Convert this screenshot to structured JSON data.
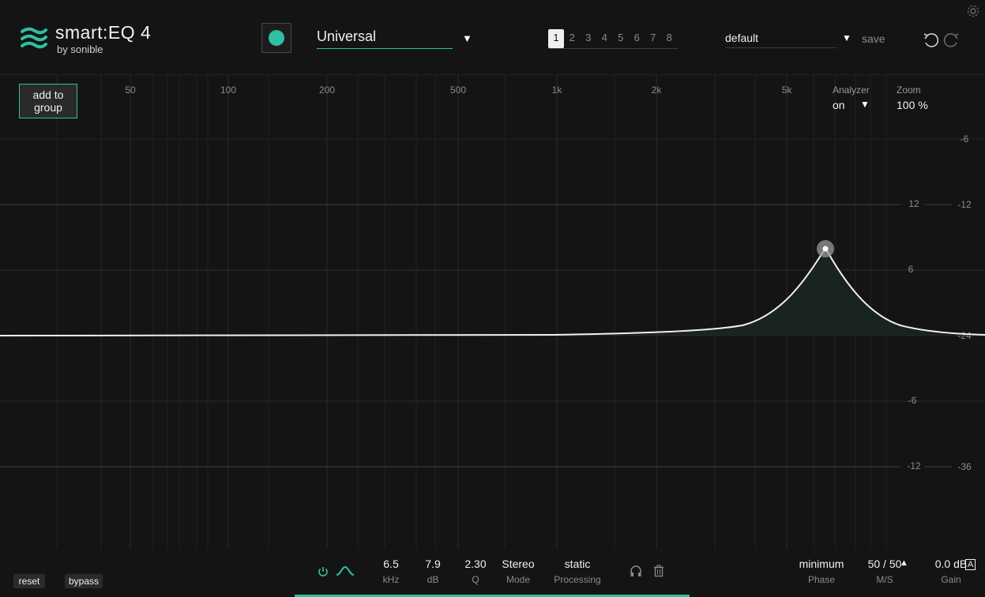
{
  "header": {
    "brand": "smart:EQ 4",
    "brand_by": "by sonible",
    "profile": "Universal",
    "slots": [
      "1",
      "2",
      "3",
      "4",
      "5",
      "6",
      "7",
      "8"
    ],
    "active_slot": "1",
    "preset": "default",
    "save_label": "save"
  },
  "add_to_group": {
    "line1": "add to",
    "line2": "group"
  },
  "analyzer": {
    "label": "Analyzer",
    "value": "on"
  },
  "zoom": {
    "label": "Zoom",
    "value": "100 %"
  },
  "freq_labels": [
    "50",
    "100",
    "200",
    "500",
    "1k",
    "2k",
    "5k"
  ],
  "gain_labels_inner": [
    "-6",
    "12",
    "6",
    "-6",
    "-12"
  ],
  "gain_labels_outer": [
    "-6",
    "-12",
    "-24",
    "-36"
  ],
  "band": {
    "freq": "6.5",
    "freq_unit": "kHz",
    "gain": "7.9",
    "gain_unit": "dB",
    "q": "2.30",
    "q_unit": "Q",
    "mode": "Stereo",
    "mode_label": "Mode",
    "processing": "static",
    "processing_label": "Processing"
  },
  "phase": {
    "value": "minimum",
    "label": "Phase"
  },
  "ms": {
    "value": "50 / 50",
    "label": "M/S"
  },
  "gain_out": {
    "value": "0.0 dB",
    "label": "Gain",
    "auto": "A"
  },
  "reset_label": "reset",
  "bypass_label": "bypass",
  "colors": {
    "accent": "#2fbfa3",
    "background": "#141414"
  },
  "icons": [
    "logo-waves-icon",
    "dropdown-arrow-icon",
    "undo-icon",
    "redo-icon",
    "gear-icon",
    "power-icon",
    "bell-filter-icon",
    "headphones-icon",
    "trash-icon",
    "triangle-up-icon"
  ]
}
